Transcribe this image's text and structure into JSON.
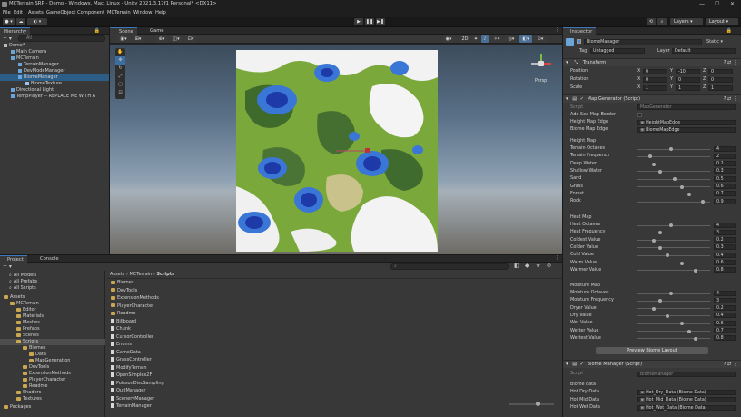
{
  "window": {
    "title": "MCTerrain SRP - Demo - Windows, Mac, Linux - Unity 2021.3.17f1 Personal* <DX11>",
    "minimize": "—",
    "maximize": "☐",
    "close": "✕"
  },
  "menu": [
    "File",
    "Edit",
    "Assets",
    "GameObject",
    "Component",
    "MCTerrain",
    "Window",
    "Help"
  ],
  "toolbar": {
    "account": "⚙",
    "layers": "Layers",
    "layout": "Layout"
  },
  "hierarchy": {
    "tab": "Hierarchy",
    "search_placeholder": "All",
    "items": [
      {
        "label": "Demo*",
        "depth": 0
      },
      {
        "label": "Main Camera",
        "depth": 1
      },
      {
        "label": "MCTerrain",
        "depth": 1
      },
      {
        "label": "TerrainManager",
        "depth": 2
      },
      {
        "label": "DevModeManager",
        "depth": 2
      },
      {
        "label": "BiomeManager",
        "depth": 2
      },
      {
        "label": "BiomeTexture",
        "depth": 3
      },
      {
        "label": "Directional Light",
        "depth": 1
      },
      {
        "label": "TempPlayer -- REPLACE ME WITH A",
        "depth": 1
      }
    ]
  },
  "scene": {
    "tab_scene": "Scene",
    "tab_game": "Game",
    "mode_2d": "2D",
    "persp": "Persp"
  },
  "project": {
    "tab_project": "Project",
    "tab_console": "Console",
    "breadcrumb": [
      "Assets",
      "MCTerrain",
      "Scripts"
    ],
    "favorites": [
      "All Models",
      "All Prefabs",
      "All Scripts"
    ],
    "tree": [
      {
        "label": "Assets",
        "depth": 0
      },
      {
        "label": "MCTerrain",
        "depth": 1
      },
      {
        "label": "Editor",
        "depth": 2
      },
      {
        "label": "Materials",
        "depth": 2
      },
      {
        "label": "Meshes",
        "depth": 2
      },
      {
        "label": "Prefabs",
        "depth": 2
      },
      {
        "label": "Scenes",
        "depth": 2
      },
      {
        "label": "Scripts",
        "depth": 2
      },
      {
        "label": "Biomes",
        "depth": 3
      },
      {
        "label": "Data",
        "depth": 4
      },
      {
        "label": "MapGeneration",
        "depth": 4
      },
      {
        "label": "DevTools",
        "depth": 3
      },
      {
        "label": "ExtensionMethods",
        "depth": 3
      },
      {
        "label": "PlayerCharacter",
        "depth": 3
      },
      {
        "label": "Readme",
        "depth": 3
      },
      {
        "label": "Shaders",
        "depth": 2
      },
      {
        "label": "Textures",
        "depth": 2
      },
      {
        "label": "Packages",
        "depth": 0
      }
    ],
    "files": [
      {
        "label": "Biomes",
        "type": "folder"
      },
      {
        "label": "DevTools",
        "type": "folder"
      },
      {
        "label": "ExtensionMethods",
        "type": "folder"
      },
      {
        "label": "PlayerCharacter",
        "type": "folder"
      },
      {
        "label": "Readme",
        "type": "folder"
      },
      {
        "label": "Billboard",
        "type": "script"
      },
      {
        "label": "Chunk",
        "type": "script"
      },
      {
        "label": "CursorController",
        "type": "script"
      },
      {
        "label": "Enums",
        "type": "script"
      },
      {
        "label": "GameData",
        "type": "script"
      },
      {
        "label": "GrassController",
        "type": "script"
      },
      {
        "label": "ModifyTerrain",
        "type": "script"
      },
      {
        "label": "OpenSimplex2F",
        "type": "script"
      },
      {
        "label": "PoissonDiscSampling",
        "type": "script"
      },
      {
        "label": "QuitManager",
        "type": "script"
      },
      {
        "label": "SceneryManager",
        "type": "script"
      },
      {
        "label": "TerrainManager",
        "type": "script"
      }
    ]
  },
  "inspector": {
    "tab": "Inspector",
    "object_name": "BiomeManager",
    "static_label": "Static",
    "tag_label": "Tag",
    "tag_value": "Untagged",
    "layer_label": "Layer",
    "layer_value": "Default",
    "transform": {
      "title": "Transform",
      "rows": [
        {
          "label": "Position",
          "x": "0",
          "y": "-10",
          "z": "0"
        },
        {
          "label": "Rotation",
          "x": "0",
          "y": "0",
          "z": "0"
        },
        {
          "label": "Scale",
          "x": "1",
          "y": "1",
          "z": "1"
        }
      ],
      "x_axis": "X",
      "y_axis": "Y",
      "z_axis": "Z"
    },
    "map_generator": {
      "title": "Map Generator (Script)",
      "script_label": "Script",
      "script_value": "MapGenerator",
      "add_sea_border": "Add Sea Map Border",
      "height_edge_label": "Height Map Edge",
      "height_edge_value": "HeightMapEdge",
      "biome_edge_label": "Biome Map Edge",
      "biome_edge_value": "BiomeMapEdge",
      "height_map_header": "Height Map",
      "height_map": [
        {
          "label": "Terrain Octaves",
          "value": "4",
          "frac": 0.45
        },
        {
          "label": "Terrain Frequency",
          "value": "2",
          "frac": 0.15
        },
        {
          "label": "Deep Water",
          "value": "0.2",
          "frac": 0.2
        },
        {
          "label": "Shallow Water",
          "value": "0.3",
          "frac": 0.3
        },
        {
          "label": "Sand",
          "value": "0.5",
          "frac": 0.5
        },
        {
          "label": "Grass",
          "value": "0.6",
          "frac": 0.6
        },
        {
          "label": "Forest",
          "value": "0.7",
          "frac": 0.7
        },
        {
          "label": "Rock",
          "value": "0.9",
          "frac": 0.9
        }
      ],
      "heat_map_header": "Heat Map",
      "heat_map": [
        {
          "label": "Heat Octaves",
          "value": "4",
          "frac": 0.45
        },
        {
          "label": "Heat Frequency",
          "value": "3",
          "frac": 0.3
        },
        {
          "label": "Coldest Value",
          "value": "0.2",
          "frac": 0.2
        },
        {
          "label": "Colder Value",
          "value": "0.3",
          "frac": 0.3
        },
        {
          "label": "Cold Value",
          "value": "0.4",
          "frac": 0.4
        },
        {
          "label": "Warm Value",
          "value": "0.6",
          "frac": 0.6
        },
        {
          "label": "Warmer Value",
          "value": "0.8",
          "frac": 0.8
        }
      ],
      "moisture_map_header": "Moisture Map",
      "moisture_map": [
        {
          "label": "Moisture Octaves",
          "value": "4",
          "frac": 0.45
        },
        {
          "label": "Moisture Frequency",
          "value": "3",
          "frac": 0.3
        },
        {
          "label": "Dryer Value",
          "value": "0.2",
          "frac": 0.2
        },
        {
          "label": "Dry Value",
          "value": "0.4",
          "frac": 0.4
        },
        {
          "label": "Wet Value",
          "value": "0.6",
          "frac": 0.6
        },
        {
          "label": "Wetter Value",
          "value": "0.7",
          "frac": 0.7
        },
        {
          "label": "Wettest Value",
          "value": "0.8",
          "frac": 0.8
        }
      ],
      "preview_button": "Preview Biome Layout"
    },
    "biome_manager": {
      "title": "Biome Manager (Script)",
      "script_label": "Script",
      "script_value": "BiomeManager",
      "biome_data_header": "Biome data",
      "rows": [
        {
          "label": "Hot Dry Data",
          "value": "Hot_Dry_Data (Biome Data)"
        },
        {
          "label": "Hot Mid Data",
          "value": "Hot_Mid_Data (Biome Data)"
        },
        {
          "label": "Hot Wet Data",
          "value": "Hot_Wet_Data (Biome Data)"
        }
      ]
    }
  },
  "colors": {
    "accent": "#3a79bb",
    "selected": "#2c5d87",
    "terrain_green": "#7aa83a",
    "water": "#2450c8"
  }
}
